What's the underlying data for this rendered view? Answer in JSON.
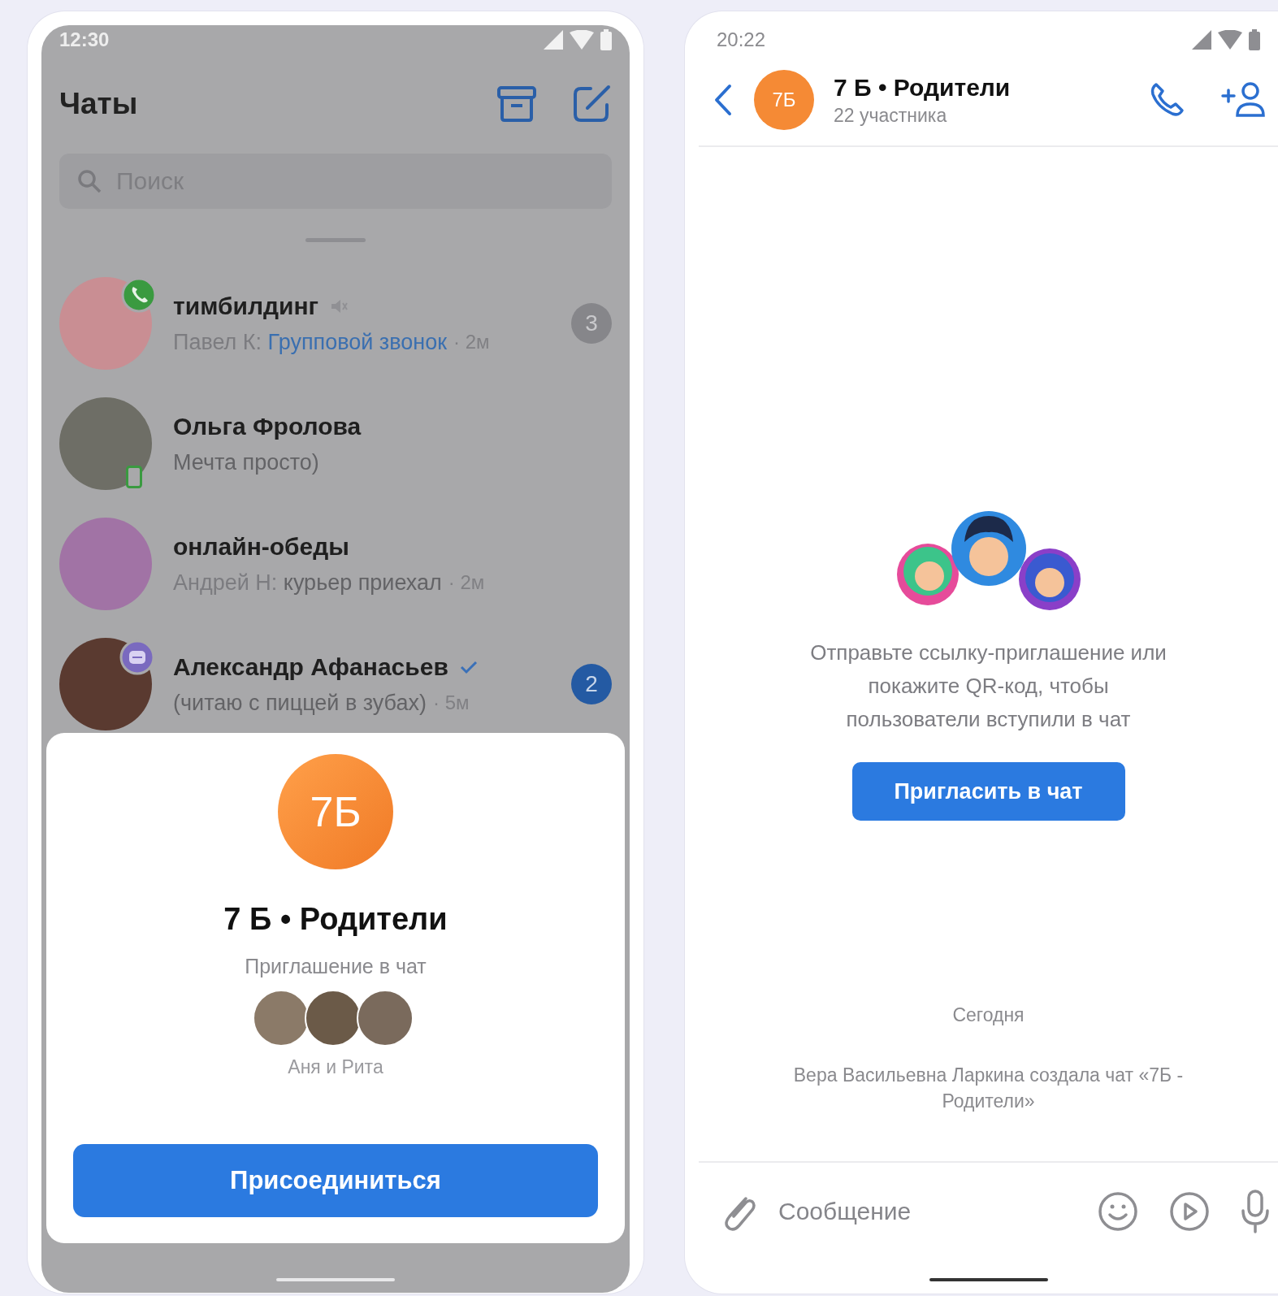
{
  "chat_list_screen": {
    "status_bar": {
      "time": "12:30"
    },
    "header": {
      "title": "Чаты"
    },
    "search": {
      "placeholder": "Поиск"
    },
    "chats": [
      {
        "name": "тимбилдинг",
        "kind": "call",
        "muted": true,
        "verified": false,
        "author": "Павел К:",
        "message": "Групповой звонок",
        "call_message": true,
        "time": "· 2м",
        "unread": "3"
      },
      {
        "name": "Ольга Фролова",
        "kind": "mobile",
        "muted": false,
        "verified": false,
        "message": "Мечта просто)",
        "call_message": false
      },
      {
        "name": "онлайн-обеды",
        "kind": "plain",
        "muted": false,
        "verified": false,
        "author": "Андрей Н:",
        "message": "курьер приехал",
        "call_message": false,
        "time": "· 2м"
      },
      {
        "name": "Александр Афанасьев",
        "kind": "group",
        "muted": false,
        "verified": true,
        "message": "(читаю с пиццей в зубах)",
        "call_message": false,
        "time": "· 5м",
        "unread": "2"
      }
    ],
    "invite_sheet": {
      "avatar_text": "7Б",
      "title": "7 Б • Родители",
      "subtitle": "Приглашение в чат",
      "member_names": "Аня и Рита",
      "button": "Присоединиться"
    }
  },
  "chat_screen": {
    "status_bar": {
      "time": "20:22"
    },
    "header": {
      "avatar_text": "7Б",
      "title": "7 Б • Родители",
      "subtitle": "22 участника"
    },
    "invite": {
      "text": "Отправьте ссылку-приглашение или покажите QR-код, чтобы пользователи вступили в чат",
      "button": "Пригласить в чат"
    },
    "date": "Сегодня",
    "system_message": "Вера Васильевна Ларкина создала чат «7Б - Родители»",
    "composer": {
      "placeholder": "Сообщение"
    }
  }
}
